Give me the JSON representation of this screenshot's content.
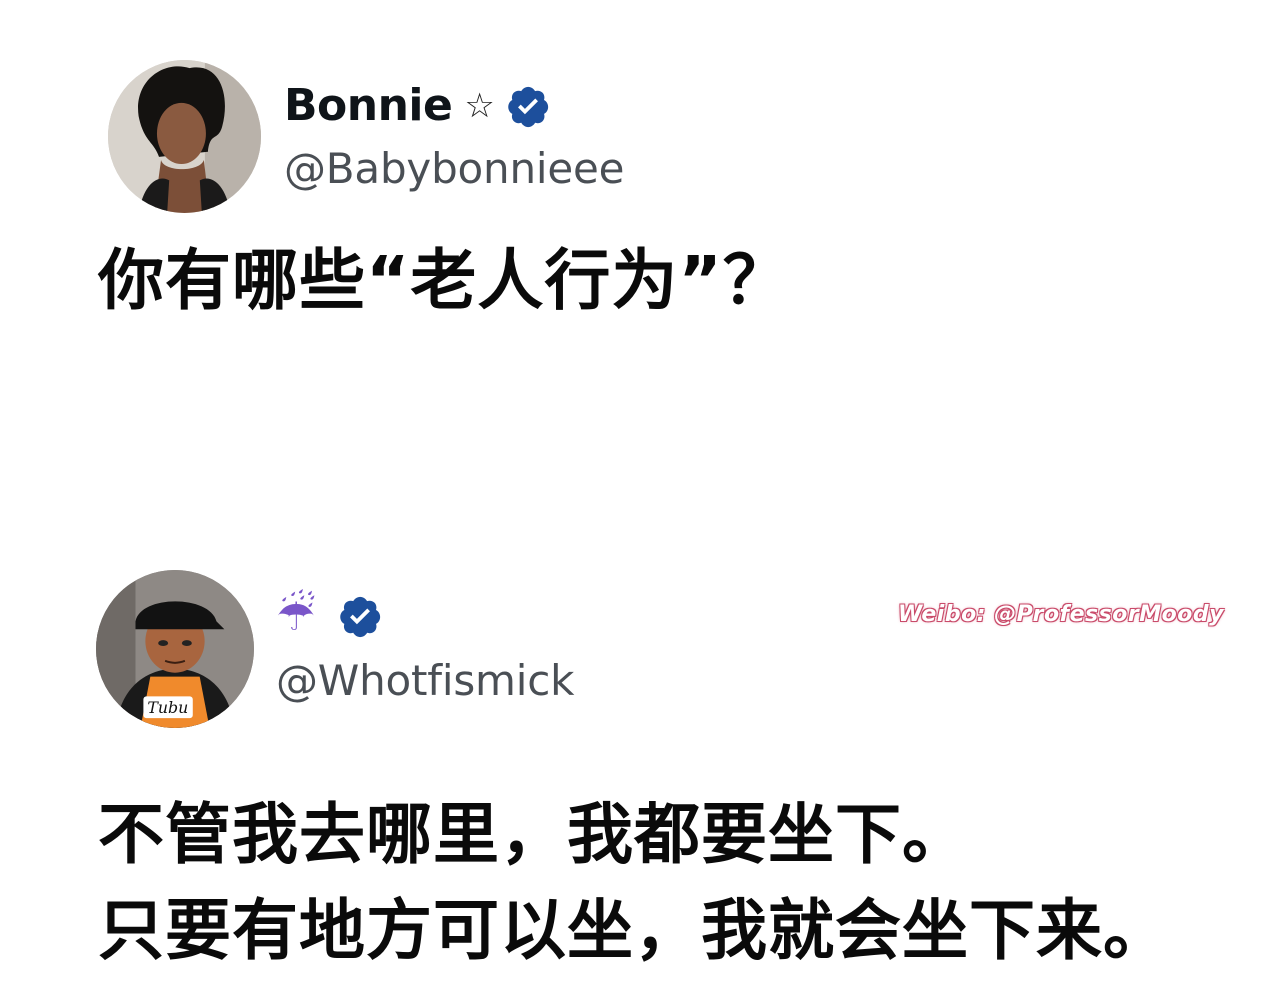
{
  "tweet1": {
    "display_name": "Bonnie",
    "name_emoji": "☆",
    "handle": "@Babybonnieee",
    "text": "你有哪些“老人行为”？",
    "avatar_icon": "profile-photo-woman"
  },
  "tweet2": {
    "display_name_emoji": "☔",
    "handle": "@Whotfismick",
    "text_lines": [
      "不管我去哪里，我都要坐下。",
      "只要有地方可以坐，我就会坐下来。"
    ],
    "avatar_icon": "cartoon-character-avatar"
  },
  "watermark": "Weibo: @ProfessorMoody",
  "colors": {
    "verified_badge": "#1d4f9c",
    "text": "#0a0a0a",
    "handle": "#4a4f55",
    "watermark_outline": "#c94b6a"
  }
}
